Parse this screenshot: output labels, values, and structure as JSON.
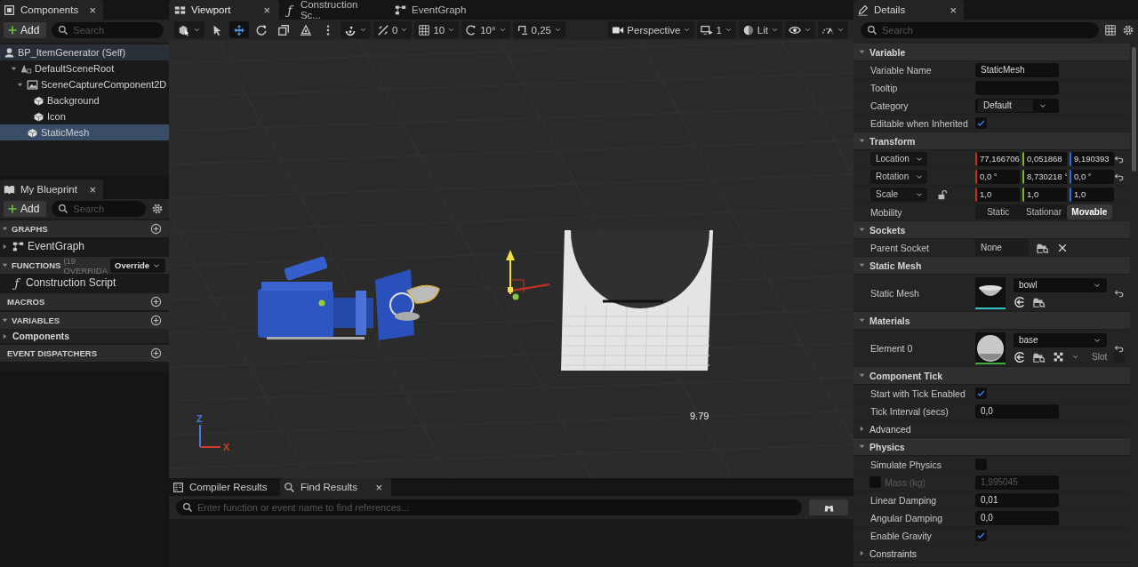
{
  "components": {
    "title": "Components",
    "close": "×",
    "add": "Add",
    "search_placeholder": "Search",
    "tree": [
      {
        "label": "BP_ItemGenerator (Self)",
        "kind": "self",
        "selected": false,
        "children": [
          {
            "label": "DefaultSceneRoot",
            "kind": "scene",
            "selected": false,
            "expanded": true,
            "children": [
              {
                "label": "SceneCaptureComponent2D",
                "kind": "capture",
                "selected": false,
                "expanded": true,
                "children": [
                  {
                    "label": "Background",
                    "kind": "mesh",
                    "selected": false
                  },
                  {
                    "label": "Icon",
                    "kind": "mesh",
                    "selected": false
                  }
                ]
              },
              {
                "label": "StaticMesh",
                "kind": "mesh",
                "selected": true
              }
            ]
          }
        ]
      }
    ]
  },
  "my_blueprint": {
    "title": "My Blueprint",
    "close": "×",
    "add": "Add",
    "search_placeholder": "Search",
    "sections": [
      {
        "title": "GRAPHS",
        "expanded": true,
        "items": [
          {
            "label": "EventGraph",
            "kind": "graph",
            "expanded": false
          }
        ]
      },
      {
        "title": "FUNCTIONS",
        "expanded": true,
        "note": "(19 OVERRIDA",
        "override": "Override",
        "items": [
          {
            "label": "Construction Script",
            "kind": "function",
            "glyph": "ƒ"
          }
        ]
      },
      {
        "title": "MACROS"
      },
      {
        "title": "VARIABLES",
        "expanded": true,
        "items": [
          {
            "label": "Components",
            "kind": "category",
            "expanded": false
          }
        ]
      },
      {
        "title": "EVENT DISPATCHERS"
      }
    ]
  },
  "editor": {
    "tabs": [
      {
        "label": "Viewport",
        "kind": "viewport",
        "selected": true,
        "close": "×"
      },
      {
        "label": "Construction Sc...",
        "kind": "function",
        "glyph": "ƒ",
        "selected": false
      },
      {
        "label": "EventGraph",
        "kind": "graph",
        "selected": false
      }
    ],
    "toolbar_left": [
      {
        "kind": "dropdown"
      },
      {
        "kind": "tool",
        "selected": false
      },
      {
        "kind": "tool",
        "selected": true
      },
      {
        "kind": "tool",
        "selected": false
      },
      {
        "kind": "tool",
        "selected": false
      },
      {
        "kind": "button"
      },
      {
        "kind": "button"
      },
      {
        "kind": "dropdown"
      },
      {
        "kind": "dropdown",
        "text": "0"
      },
      {
        "kind": "dropdown",
        "text": "10"
      },
      {
        "kind": "dropdown",
        "text": "10°"
      },
      {
        "kind": "dropdown",
        "text": "0,25"
      }
    ],
    "toolbar_right": [
      {
        "kind": "dropdown",
        "text": "Perspective"
      },
      {
        "kind": "dropdown",
        "text": "1"
      },
      {
        "kind": "dropdown",
        "text": "Lit"
      },
      {
        "kind": "dropdown"
      },
      {
        "kind": "dropdown"
      }
    ],
    "viewport": {
      "readout": "9.79",
      "axes": [
        {
          "label": "Z",
          "color": "#4a78e0"
        },
        {
          "label": "X",
          "color": "#d03a30"
        }
      ]
    }
  },
  "bottom_panel": {
    "tabs": [
      {
        "label": "Compiler Results",
        "kind": "compiler",
        "selected": false
      },
      {
        "label": "Find Results",
        "kind": "search",
        "selected": true,
        "close": "×"
      }
    ],
    "search_placeholder": "Enter function or event name to find references..."
  },
  "details": {
    "title": "Details",
    "close": "×",
    "search_placeholder": "Search",
    "sections": [
      {
        "title": "Variable",
        "kind": "category",
        "expanded": true,
        "rows": [
          {
            "kind": "text",
            "label": "Variable Name",
            "value": "StaticMesh"
          },
          {
            "kind": "text",
            "label": "Tooltip"
          },
          {
            "kind": "combo",
            "label": "Category",
            "value": "Default"
          },
          {
            "kind": "checkbox",
            "label": "Editable when Inherited",
            "checked": true
          }
        ]
      },
      {
        "title": "Transform",
        "kind": "category",
        "expanded": true,
        "rows": [
          {
            "kind": "vector",
            "label": "Location",
            "values": [
              "77,166706",
              "0,051868",
              "9,190393"
            ],
            "resettable": true
          },
          {
            "kind": "vector",
            "label": "Rotation",
            "values": [
              "0,0 °",
              "8,730218 °",
              "0,0 °"
            ],
            "resettable": true
          },
          {
            "kind": "vector",
            "label": "Scale",
            "values": [
              "1,0",
              "1,0",
              "1,0"
            ],
            "locked": false,
            "resettable": false
          },
          {
            "kind": "segmented",
            "label": "Mobility",
            "options": [
              {
                "label": "Static",
                "selected": false
              },
              {
                "label": "Stationar",
                "selected": false
              },
              {
                "label": "Movable",
                "selected": true
              }
            ]
          }
        ]
      },
      {
        "title": "Sockets",
        "kind": "category",
        "expanded": true,
        "rows": [
          {
            "kind": "socket",
            "label": "Parent Socket",
            "value": "None"
          }
        ]
      },
      {
        "title": "Static Mesh",
        "kind": "category",
        "expanded": true,
        "rows": [
          {
            "kind": "mesh",
            "label": "Static Mesh",
            "value": "bowl",
            "resettable": true
          }
        ]
      },
      {
        "title": "Materials",
        "kind": "category",
        "expanded": true,
        "rows": [
          {
            "kind": "material",
            "label": "Element 0",
            "value": "base",
            "slot": "Slot",
            "resettable": true
          }
        ]
      },
      {
        "title": "Component Tick",
        "kind": "category",
        "expanded": true,
        "rows": [
          {
            "kind": "checkbox",
            "label": "Start with Tick Enabled",
            "checked": true
          },
          {
            "kind": "text",
            "label": "Tick Interval (secs)",
            "value": "0,0"
          }
        ]
      },
      {
        "title": "Advanced",
        "kind": "subgroup",
        "expanded": false
      },
      {
        "title": "Physics",
        "kind": "category",
        "expanded": true,
        "rows": [
          {
            "kind": "checkbox",
            "label": "Simulate Physics",
            "checked": false
          },
          {
            "kind": "override",
            "label": "Mass (kg)",
            "override": false,
            "value": "1,995045",
            "disabled": true
          },
          {
            "kind": "text",
            "label": "Linear Damping",
            "value": "0,01"
          },
          {
            "kind": "text",
            "label": "Angular Damping",
            "value": "0,0"
          },
          {
            "kind": "checkbox",
            "label": "Enable Gravity",
            "checked": true
          }
        ]
      },
      {
        "title": "Constraints",
        "kind": "subgroup",
        "expanded": false
      }
    ]
  }
}
